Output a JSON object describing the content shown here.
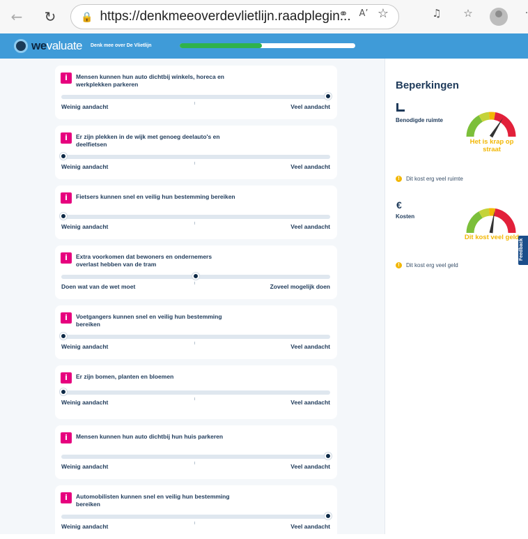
{
  "browser": {
    "url": "https://denkmeeoverdevlietlijn.raadplegin..."
  },
  "header": {
    "logo_bold": "we",
    "logo_light": "valuate",
    "subtitle": "Denk mee over De Vlietlijn",
    "progress": 0.47
  },
  "cards": [
    {
      "title": "Mensen kunnen hun auto dichtbij winkels, horeca en werkplekken parkeren",
      "left": "Weinig aandacht",
      "right": "Veel aandacht",
      "value": 1.0
    },
    {
      "title": "Er zijn plekken in de wijk met genoeg deelauto's en deelfietsen",
      "left": "Weinig aandacht",
      "right": "Veel aandacht",
      "value": 0.0
    },
    {
      "title": "Fietsers kunnen snel en veilig hun bestemming bereiken",
      "left": "Weinig aandacht",
      "right": "Veel aandacht",
      "value": 0.0
    },
    {
      "title": "Extra voorkomen dat bewoners en ondernemers overlast hebben van de tram",
      "left": "Doen wat van de wet moet",
      "right": "Zoveel mogelijk doen",
      "value": 0.5
    },
    {
      "title": "Voetgangers kunnen snel en veilig hun bestemming bereiken",
      "left": "Weinig aandacht",
      "right": "Veel aandacht",
      "value": 0.0
    },
    {
      "title": "Er zijn bomen, planten en bloemen",
      "left": "Weinig aandacht",
      "right": "Veel aandacht",
      "value": 0.0
    },
    {
      "title": "Mensen kunnen hun auto dichtbij hun huis parkeren",
      "left": "Weinig aandacht",
      "right": "Veel aandacht",
      "value": 1.0
    },
    {
      "title": "Automobilisten kunnen snel en veilig hun bestemming bereiken",
      "left": "Weinig aandacht",
      "right": "Veel aandacht",
      "value": 1.0
    }
  ],
  "constraints": {
    "title": "Beperkingen",
    "space": {
      "label": "Benodigde ruimte",
      "gauge_text": "Het is krap op straat",
      "warning": "Dit kost erg veel ruimte",
      "level": 0.68
    },
    "cost": {
      "label": "Kosten",
      "gauge_text": "Dit kost veel geld",
      "warning": "Dit kost erg veel geld",
      "level": 0.55
    }
  },
  "feedback_label": "Feedback",
  "colors": {
    "header": "#3f9bd8",
    "progress": "#2fb24c",
    "info": "#e6007e",
    "gauge_text": "#f2b705"
  }
}
